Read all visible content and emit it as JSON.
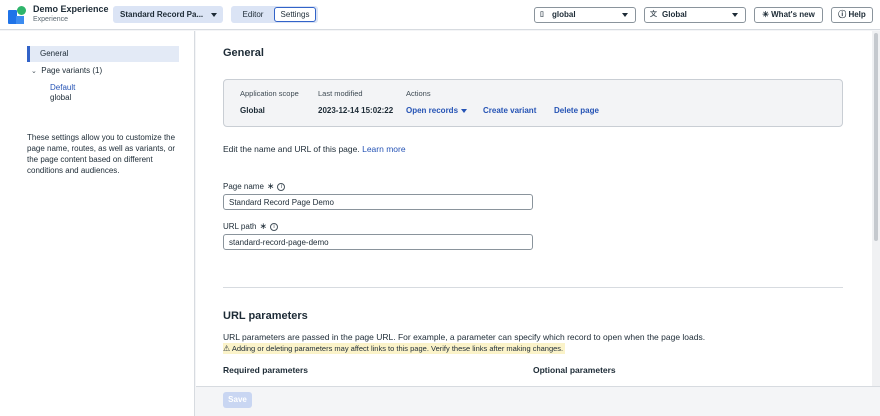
{
  "app": {
    "title": "Demo Experience",
    "subtitle": "Experience"
  },
  "header": {
    "page_select": "Standard Record Pa...",
    "tabs": [
      {
        "label": "Editor"
      },
      {
        "label": "Settings"
      }
    ],
    "scope_select": "global",
    "language_select": "Global",
    "whats_new_label": "What's new",
    "help_label": "Help"
  },
  "sidebar": {
    "items": [
      {
        "label": "General"
      },
      {
        "label": "Page variants (1)"
      }
    ],
    "variant": {
      "name": "Default",
      "scope": "global"
    },
    "help_text": "These settings allow you to customize the page name, routes, as well as variants, or the page content based on different conditions and audiences."
  },
  "general": {
    "heading": "General",
    "summary": {
      "scope_label": "Application scope",
      "scope_value": "Global",
      "modified_label": "Last modified",
      "modified_value": "2023-12-14 15:02:22",
      "actions_label": "Actions",
      "actions": [
        "Open records",
        "Create variant",
        "Delete page"
      ]
    },
    "edit_text": "Edit the name and URL of this page.",
    "learn_more": "Learn more",
    "page_name_label": "Page name",
    "page_name_value": "Standard Record Page Demo",
    "url_path_label": "URL path",
    "url_path_value": "standard-record-page-demo"
  },
  "url_params": {
    "heading": "URL parameters",
    "description": "URL parameters are passed in the page URL. For example, a parameter can specify which record to open when the page loads.",
    "warning": "Adding or deleting parameters may affect links to this page. Verify these links after making changes.",
    "required_heading": "Required parameters",
    "optional_heading": "Optional parameters"
  },
  "footer": {
    "save_label": "Save"
  }
}
